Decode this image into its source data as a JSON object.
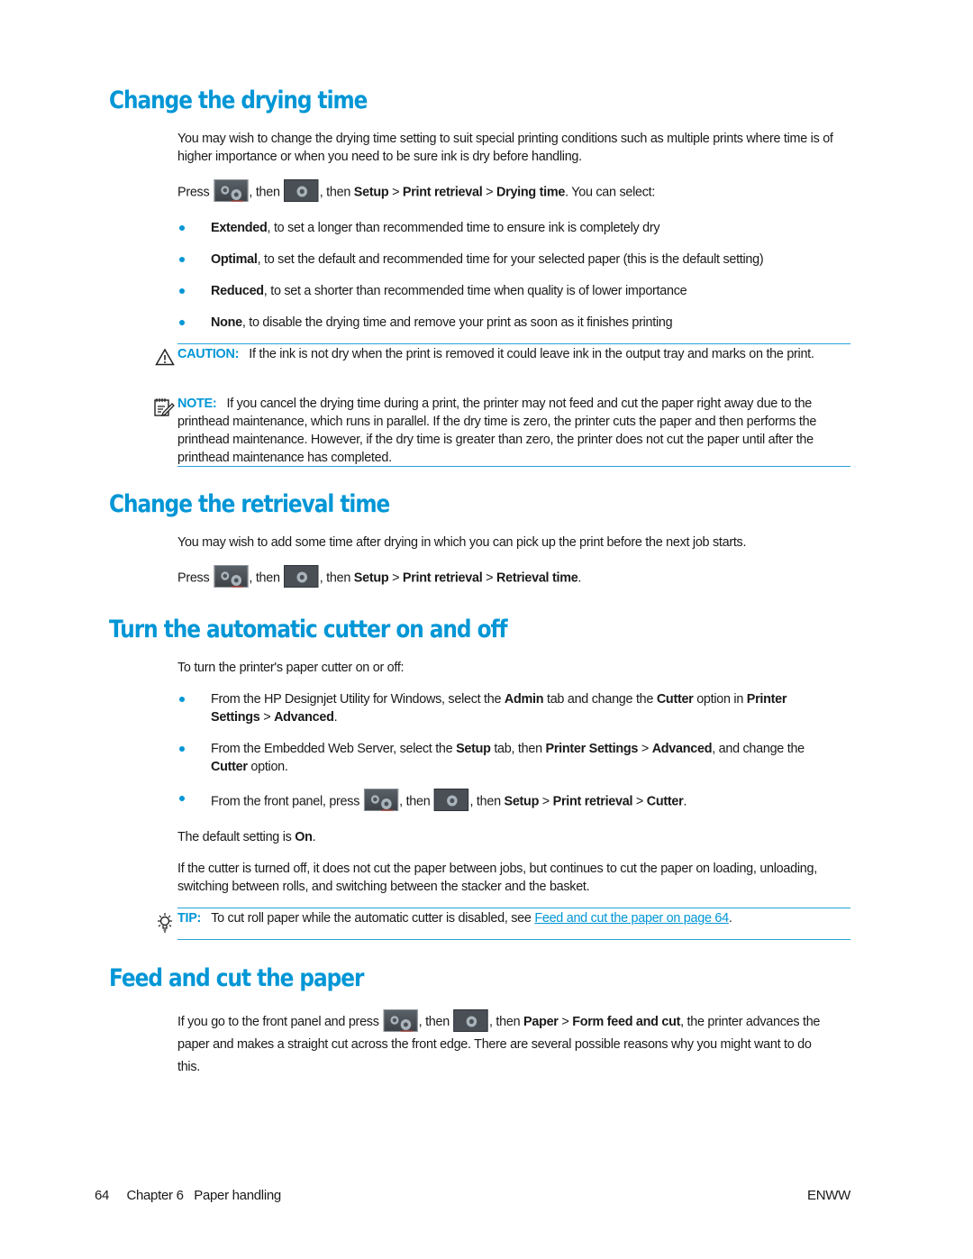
{
  "sections": {
    "drying": {
      "title": "Change the drying time",
      "intro": "You may wish to change the drying time setting to suit special printing conditions such as multiple prints where time is of higher importance or when you need to be sure ink is dry before handling.",
      "press": {
        "pre": "Press",
        "then1": ", then",
        "then2": ", then",
        "path1": "Setup",
        "sep": ">",
        "path2": "Print retrieval",
        "path3": "Drying time",
        "post": ". You can select:"
      },
      "options": [
        {
          "name": "Extended",
          "desc": ", to set a longer than recommended time to ensure ink is completely dry"
        },
        {
          "name": "Optimal",
          "desc": ", to set the default and recommended time for your selected paper (this is the default setting)"
        },
        {
          "name": "Reduced",
          "desc": ", to set a shorter than recommended time when quality is of lower importance"
        },
        {
          "name": "None",
          "desc": ", to disable the drying time and remove your print as soon as it finishes printing"
        }
      ],
      "caution": {
        "label": "CAUTION:",
        "text": "If the ink is not dry when the print is removed it could leave ink in the output tray and marks on the print."
      },
      "note": {
        "label": "NOTE:",
        "text": "If you cancel the drying time during a print, the printer may not feed and cut the paper right away due to the printhead maintenance, which runs in parallel. If the dry time is zero, the printer cuts the paper and then performs the printhead maintenance. However, if the dry time is greater than zero, the printer does not cut the paper until after the printhead maintenance has completed."
      }
    },
    "retrieval": {
      "title": "Change the retrieval time",
      "intro": "You may wish to add some time after drying in which you can pick up the print before the next job starts.",
      "press": {
        "pre": "Press",
        "then1": ", then",
        "then2": ", then",
        "path1": "Setup",
        "sep": ">",
        "path2": "Print retrieval",
        "path3": "Retrieval time",
        "post": "."
      }
    },
    "cutter": {
      "title": "Turn the automatic cutter on and off",
      "intro": "To turn the printer's paper cutter on or off:",
      "bullets": [
        {
          "t1": "From the HP Designjet Utility for Windows, select the ",
          "b1": "Admin",
          "t2": " tab and change the ",
          "b2": "Cutter",
          "t3": " option in ",
          "b3": "Printer Settings",
          "t4": " > ",
          "b4": "Advanced",
          "t5": "."
        },
        {
          "t1": "From the Embedded Web Server, select the ",
          "b1": "Setup",
          "t2": " tab, then ",
          "b2": "Printer Settings",
          "t3": " > ",
          "b3": "Advanced",
          "t4": ", and change the ",
          "b4": "Cutter",
          "t5": " option."
        },
        {
          "pre": "From the front panel, press",
          "then1": ", then",
          "then2": ", then",
          "path1": "Setup",
          "sep": ">",
          "path2": "Print retrieval",
          "path3": "Cutter",
          "post": "."
        }
      ],
      "default_pre": "The default setting is ",
      "default_value": "On",
      "default_post": ".",
      "off_text": "If the cutter is turned off, it does not cut the paper between jobs, but continues to cut the paper on loading, unloading, switching between rolls, and switching between the stacker and the basket.",
      "tip": {
        "label": "TIP:",
        "text": "To cut roll paper while the automatic cutter is disabled, see ",
        "link": "Feed and cut the paper on page 64",
        "post": "."
      }
    },
    "feed": {
      "title": "Feed and cut the paper",
      "pre": "If you go to the front panel and press",
      "then1": ", then",
      "then2": ", then",
      "path1": "Paper",
      "sep": ">",
      "path2": "Form feed and cut",
      "post": ", the printer advances the paper and makes a straight cut across the front edge. There are several possible reasons why you might want to do this."
    }
  },
  "icons": {
    "tools": "settings-tools-icon",
    "gear": "gear-icon",
    "caution": "warning-triangle-icon",
    "note": "note-pencil-icon",
    "tip": "lightbulb-icon"
  },
  "colors": {
    "accent": "#0096d6",
    "rule": "#27a4dc",
    "icon_bg": "#4a4f55"
  },
  "footer": {
    "page_number": "64",
    "chapter": "Chapter 6",
    "chapter_title": "Paper handling",
    "locale": "ENWW"
  }
}
